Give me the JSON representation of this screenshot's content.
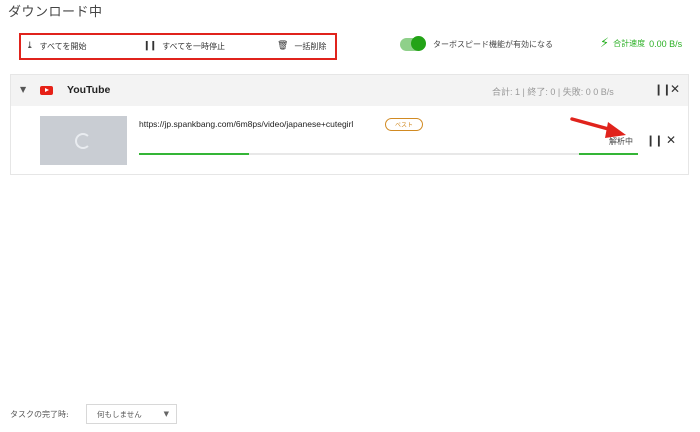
{
  "page": {
    "title": "ダウンロード中"
  },
  "toolbar": {
    "start_all": "すべてを開始",
    "pause_all": "すべてを一時停止",
    "delete_all": "一括削除"
  },
  "turbo": {
    "label": "ターボスピード機能が有効になる",
    "enabled": true
  },
  "speed": {
    "label": "合計速度",
    "value": "0.00 B/s"
  },
  "group": {
    "name": "YouTube",
    "stats": "合計: 1 | 終了: 0 | 失敗: 0   0 B/s"
  },
  "item": {
    "url": "https://jp.spankbang.com/6m8ps/video/japanese+cutegirl",
    "quality_badge": "ベスト",
    "status": "解析中",
    "progress": 0.22
  },
  "footer": {
    "on_complete_label": "タスクの完了時:",
    "on_complete_value": "何もしません"
  },
  "colors": {
    "accent": "#2bb024",
    "highlight": "#e0231c",
    "badge": "#d18a22"
  }
}
